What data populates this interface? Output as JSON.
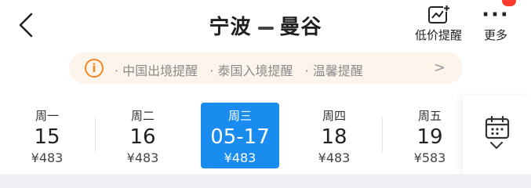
{
  "header": {
    "origin": "宁波",
    "destination": "曼谷",
    "price_alert_label": "低价提醒",
    "more_label": "更多",
    "badge_count": ""
  },
  "notice": {
    "items": [
      "· 中国出境提醒",
      "· 泰国入境提醒",
      "· 温馨提醒"
    ]
  },
  "dates": [
    {
      "weekday": "周一",
      "date": "15",
      "price": "¥483",
      "selected": false
    },
    {
      "weekday": "周二",
      "date": "16",
      "price": "¥483",
      "selected": false
    },
    {
      "weekday": "周三",
      "date": "05-17",
      "price": "¥483",
      "selected": true
    },
    {
      "weekday": "周四",
      "date": "18",
      "price": "¥483",
      "selected": false
    },
    {
      "weekday": "周五",
      "date": "19",
      "price": "¥583",
      "selected": false
    }
  ],
  "colors": {
    "accent": "#1a8cf0",
    "notice_bg": "#fdf4ec",
    "info_orange": "#f08a24",
    "badge_red": "#ff3b30"
  }
}
